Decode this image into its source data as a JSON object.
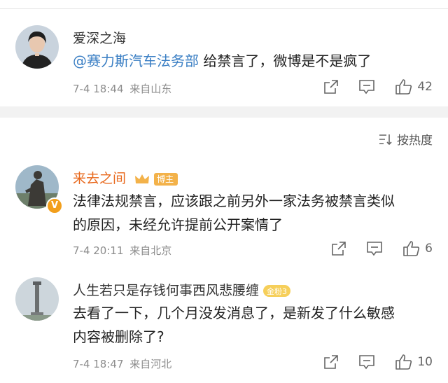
{
  "comments": [
    {
      "name": "爱深之海",
      "mention": "@赛力斯汽车法务部",
      "text": " 给禁言了，微博是不是疯了",
      "time": "7-4 18:44",
      "location": "来自山东",
      "likes": "42",
      "avatar_icon": "person-avatar-icon"
    },
    {
      "name": "来去之间",
      "badge": "博主",
      "text_line1": "法律法规禁言，应该跟之前另外一家法务被禁言类似",
      "text_line2": "的原因，未经允许提前公开案情了",
      "time": "7-4 20:11",
      "location": "来自北京",
      "likes": "6",
      "avatar_icon": "sculpture-avatar-icon"
    },
    {
      "name": "人生若只是存钱何事西风悲腰缠",
      "badge": "金粉3",
      "text_line1": "去看了一下，几个月没发消息了，是新发了什么敏感",
      "text_line2": "内容被删除了?",
      "time": "7-4 18:47",
      "location": "来自河北",
      "likes": "10",
      "avatar_icon": "tower-avatar-icon"
    }
  ],
  "sort": {
    "label": "按热度"
  },
  "colors": {
    "accent": "#3b7fc4",
    "blogger_name": "#e8681c",
    "meta": "#8c8c8c"
  }
}
